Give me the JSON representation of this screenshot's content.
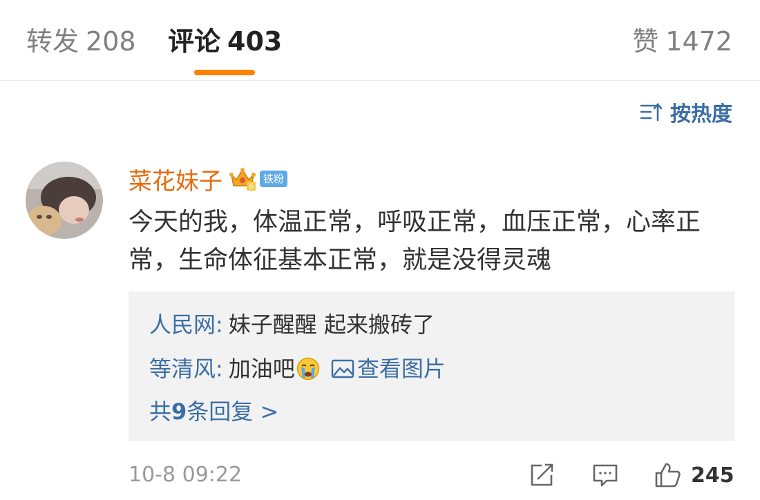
{
  "tabs": [
    {
      "label": "转发",
      "count": "208"
    },
    {
      "label": "评论",
      "count": "403"
    },
    {
      "label": "赞",
      "count": "1472"
    }
  ],
  "sort": {
    "label": "按热度",
    "icon": "sort-icon"
  },
  "comment": {
    "username": "菜花妹子",
    "crown_level": "6",
    "fan_badge": "铁粉",
    "text": "今天的我，体温正常，呼吸正常，血压正常，心率正常，生命体征基本正常，就是没得灵魂",
    "timestamp": "10-8 09:22",
    "like_count": "245"
  },
  "replies": [
    {
      "author": "人民网",
      "text": "妹子醒醒 起来搬砖了"
    },
    {
      "author": "等清风",
      "text": "加油吧",
      "view_pic": "查看图片"
    }
  ],
  "more_replies": {
    "prefix": "共",
    "count": "9",
    "suffix": "条回复 >"
  },
  "colors": {
    "accent": "#ff8200",
    "link": "#3a6ea5",
    "username": "#e86b0c",
    "reply_bg": "#f2f2f2"
  }
}
